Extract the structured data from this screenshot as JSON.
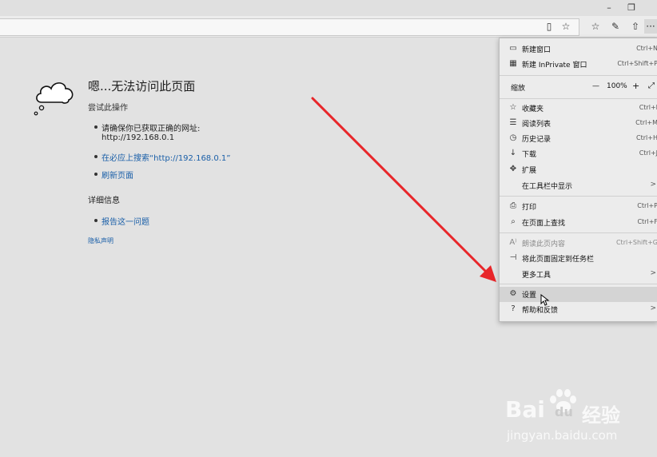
{
  "window": {
    "minimize_glyph": "–",
    "restore_glyph": "❐"
  },
  "toolbar": {
    "reading_view_glyph": "▯",
    "favorite_glyph": "☆",
    "favorites_glyph": "☆",
    "pen_glyph": "✎",
    "share_glyph": "⇧",
    "more_glyph": "···"
  },
  "error_page": {
    "title": "嗯...无法访问此页面",
    "subtitle": "尝试此操作",
    "check_line1": "请确保你已获取正确的网址:",
    "check_line2": "http://192.168.0.1",
    "search_link": "在必应上搜索“http://192.168.0.1”",
    "refresh_link": "刷新页面",
    "details_heading": "详细信息",
    "report_link": "报告这一问题",
    "privacy_link": "隐私声明"
  },
  "menu": {
    "new_window": {
      "label": "新建窗口",
      "shortcut": "Ctrl+N"
    },
    "new_inprivate": {
      "label": "新建 InPrivate 窗口",
      "shortcut": "Ctrl+Shift+P"
    },
    "zoom": {
      "label": "缩放",
      "minus": "—",
      "value": "100%",
      "plus": "+",
      "fullscreen": "⤢"
    },
    "favorites": {
      "label": "收藏夹",
      "shortcut": "Ctrl+I"
    },
    "reading_list": {
      "label": "阅读列表",
      "shortcut": "Ctrl+M"
    },
    "history": {
      "label": "历史记录",
      "shortcut": "Ctrl+H"
    },
    "downloads": {
      "label": "下载",
      "shortcut": "Ctrl+J"
    },
    "extensions": {
      "label": "扩展"
    },
    "show_in_toolbar": {
      "label": "在工具栏中显示",
      "arrow": ">"
    },
    "print": {
      "label": "打印",
      "shortcut": "Ctrl+P"
    },
    "find_on_page": {
      "label": "在页面上查找",
      "shortcut": "Ctrl+F"
    },
    "read_aloud": {
      "label": "朗读此页内容",
      "shortcut": "Ctrl+Shift+G"
    },
    "pin_to_taskbar": {
      "label": "将此页面固定到任务栏"
    },
    "more_tools": {
      "label": "更多工具",
      "arrow": ">"
    },
    "settings": {
      "label": "设置"
    },
    "help_feedback": {
      "label": "帮助和反馈",
      "arrow": ">"
    }
  },
  "watermark": {
    "brand": "Bai",
    "brand2": "du",
    "cn": "经验",
    "url": "jingyan.baidu.com"
  },
  "colors": {
    "arrow": "#e8262a",
    "link": "#1a5fa8",
    "menu_bg": "#ececec",
    "page_bg": "#e2e2e2"
  }
}
